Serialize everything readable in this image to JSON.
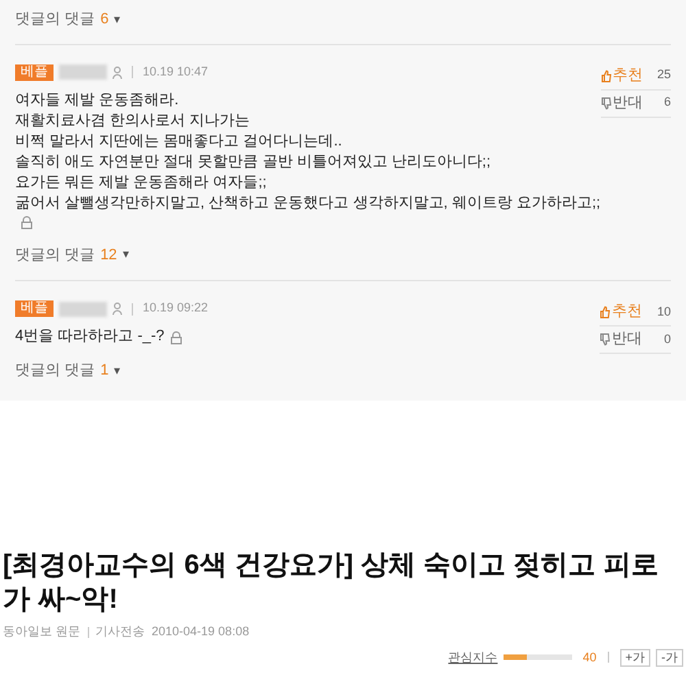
{
  "top_replies": {
    "label": "댓글의 댓글",
    "count": "6",
    "caret": "▾"
  },
  "comments": [
    {
      "badge": "베플",
      "time": "10.19 10:47",
      "lines": [
        "여자들 제발 운동좀해라.",
        "재활치료사겸 한의사로서 지나가는",
        "비쩍 말라서 지딴에는 몸매좋다고 걸어다니는데..",
        "솔직히 애도 자연분만 절대 못할만큼 골반 비틀어져있고 난리도아니다;;",
        "요가든 뭐든 제발 운동좀해라 여자들;;",
        "굶어서 살뺄생각만하지말고, 산책하고 운동했다고 생각하지말고, 웨이트랑 요가하라고;;"
      ],
      "lock_below": true,
      "up_label": "추천",
      "up_count": "25",
      "down_label": "반대",
      "down_count": "6",
      "replies_label": "댓글의 댓글",
      "replies_count": "12",
      "caret": "▾"
    },
    {
      "badge": "베플",
      "time": "10.19 09:22",
      "lines": [
        "4번을 따라하라고 -_-?"
      ],
      "lock_below": false,
      "up_label": "추천",
      "up_count": "10",
      "down_label": "반대",
      "down_count": "0",
      "replies_label": "댓글의 댓글",
      "replies_count": "1",
      "caret": "▾"
    }
  ],
  "article": {
    "title": "[최경아교수의 6색 건강요가] 상체 숙이고 젖히고 피로가 싸~악!",
    "source": "동아일보 원문",
    "sent_label": "기사전송",
    "sent_time": "2010-04-19 08:08",
    "interest_label": "관심지수",
    "interest": {
      "level": 0.35
    },
    "interest_value": "40",
    "font_up": "+가",
    "font_down": "-가"
  }
}
